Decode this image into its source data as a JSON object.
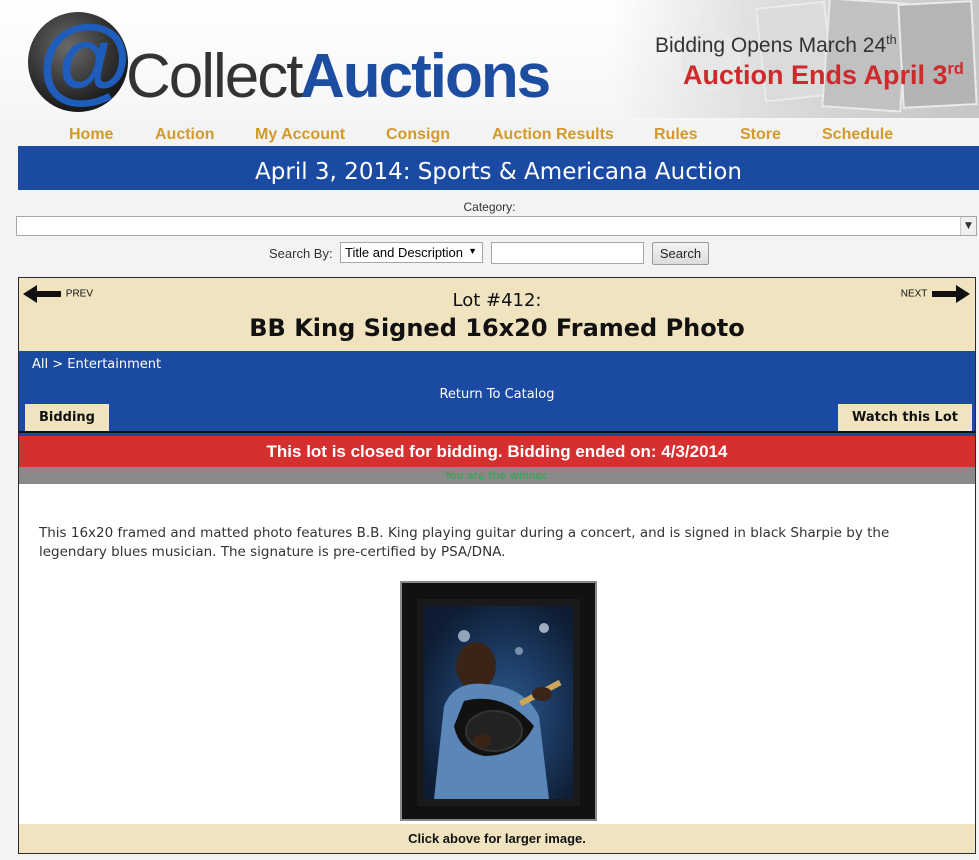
{
  "header": {
    "logo_at": "@",
    "logo_collect": "Collect",
    "logo_auctions": "Auctions",
    "bidding_opens": "Bidding Opens March 24",
    "bidding_opens_suffix": "th",
    "auction_ends": "Auction Ends April 3",
    "auction_ends_suffix": "rd"
  },
  "nav": {
    "items": [
      "Home",
      "Auction",
      "My Account",
      "Consign",
      "Auction Results",
      "Rules",
      "Store",
      "Schedule"
    ]
  },
  "title_bar": "April 3, 2014: Sports & Americana Auction",
  "search": {
    "category_label": "Category:",
    "category_value": "",
    "search_by_label": "Search By:",
    "search_by_value": "Title and Description",
    "search_input_value": "",
    "search_button": "Search"
  },
  "lot": {
    "prev_label": "PREV",
    "next_label": "NEXT",
    "number": "Lot #412:",
    "title": "BB King Signed 16x20 Framed Photo",
    "breadcrumb_all": "All",
    "breadcrumb_sep": " > ",
    "breadcrumb_cat": "Entertainment",
    "return_label": "Return To Catalog",
    "tab_bidding": "Bidding",
    "tab_watch": "Watch this Lot",
    "closed_message": "This lot is closed for bidding. Bidding ended on: 4/3/2014",
    "winner_message": "You are the winner.",
    "description": "This 16x20 framed and matted photo features B.B. King playing guitar during a concert, and is signed in black Sharpie by the legendary blues musician. The signature is pre-certified by PSA/DNA.",
    "caption": "Click above for larger image."
  },
  "colors": {
    "blue": "#1b4aa3",
    "tan": "#efe3c0",
    "red": "#d62f2f",
    "nav_gold": "#d29a2c",
    "winner_green": "#2aa84a"
  }
}
